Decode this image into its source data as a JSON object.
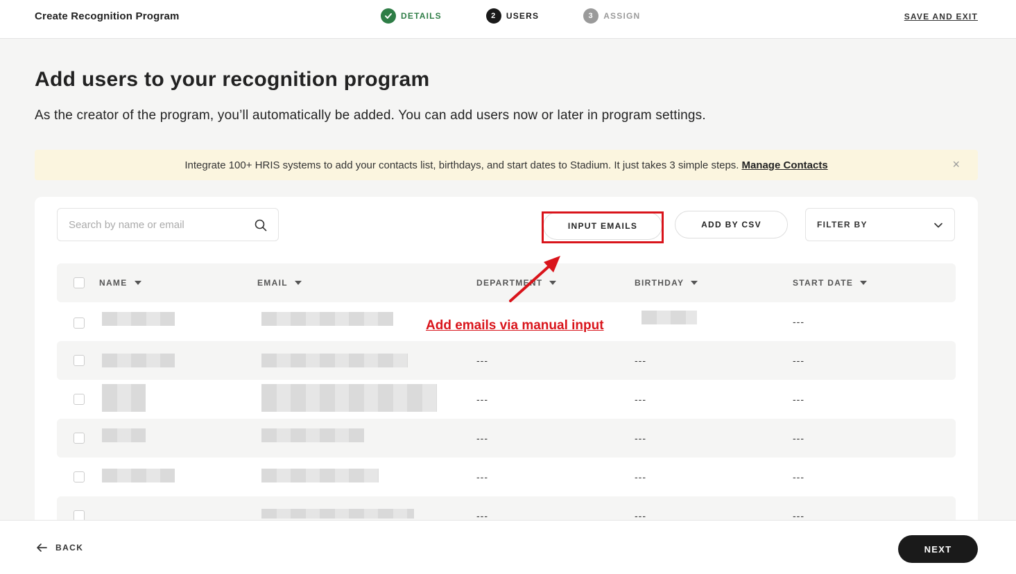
{
  "topbar": {
    "title": "Create Recognition Program",
    "steps": [
      {
        "number": "",
        "label": "DETAILS",
        "state": "done"
      },
      {
        "number": "2",
        "label": "USERS",
        "state": "active"
      },
      {
        "number": "3",
        "label": "ASSIGN",
        "state": "todo"
      }
    ],
    "save_exit": "SAVE AND EXIT"
  },
  "header": {
    "title": "Add users to your recognition program",
    "subtitle": "As the creator of the program, you’ll automatically be added. You can add users now or later in program settings."
  },
  "banner": {
    "text": "Integrate 100+ HRIS systems to add your contacts list, birthdays, and start dates to Stadium. It just takes 3 simple steps.",
    "link": "Manage Contacts",
    "close": "×"
  },
  "toolbar": {
    "search_placeholder": "Search by name or email",
    "input_emails": "INPUT EMAILS",
    "add_by_csv": "ADD BY CSV",
    "filter_by": "FILTER BY"
  },
  "table": {
    "columns": [
      "NAME",
      "EMAIL",
      "DEPARTMENT",
      "BIRTHDAY",
      "START DATE"
    ],
    "rows": [
      {
        "department": "",
        "birthday": "",
        "start_date": "---"
      },
      {
        "department": "---",
        "birthday": "---",
        "start_date": "---"
      },
      {
        "department": "---",
        "birthday": "---",
        "start_date": "---"
      },
      {
        "department": "---",
        "birthday": "---",
        "start_date": "---"
      },
      {
        "department": "---",
        "birthday": "---",
        "start_date": "---"
      },
      {
        "department": "---",
        "birthday": "---",
        "start_date": "---"
      }
    ]
  },
  "annotation": {
    "text": "Add emails via manual input",
    "color": "#d9141b"
  },
  "footer": {
    "back": "BACK",
    "next": "NEXT"
  },
  "colors": {
    "done": "#2e7d46",
    "active": "#1a1a1a",
    "todo": "#9a9a9a",
    "banner_bg": "#fbf5df"
  }
}
